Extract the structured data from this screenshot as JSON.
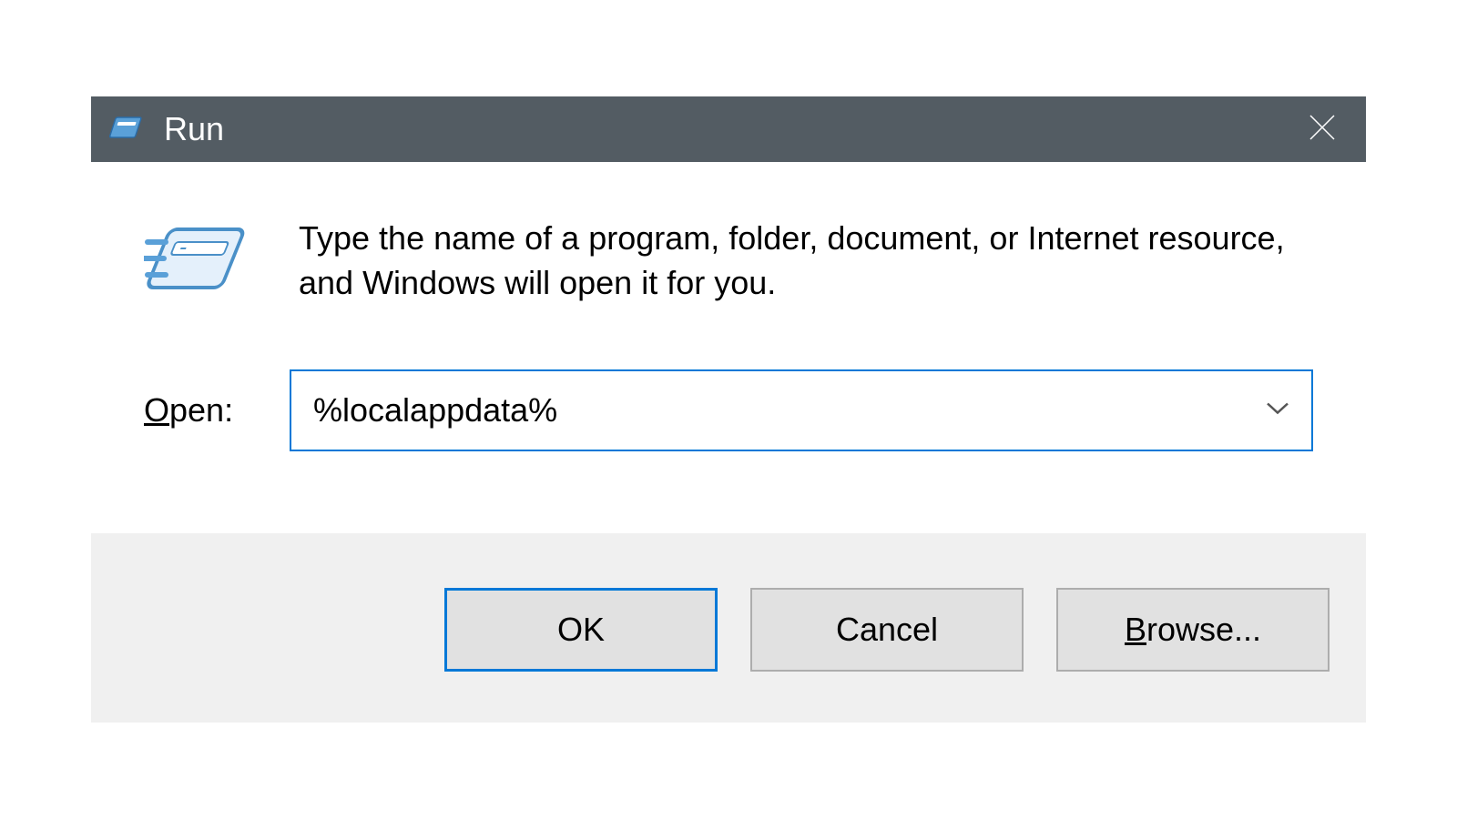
{
  "titlebar": {
    "title": "Run"
  },
  "body": {
    "description": "Type the name of a program, folder, document, or Internet resource, and Windows will open it for you.",
    "open_label_prefix": "O",
    "open_label_rest": "pen:",
    "input_value": "%localappdata%"
  },
  "buttons": {
    "ok": "OK",
    "cancel": "Cancel",
    "browse_prefix": "B",
    "browse_rest": "rowse..."
  },
  "colors": {
    "titlebar_bg": "#535c63",
    "accent": "#0078d7",
    "button_bg": "#e1e1e1",
    "button_area_bg": "#f0f0f0"
  }
}
